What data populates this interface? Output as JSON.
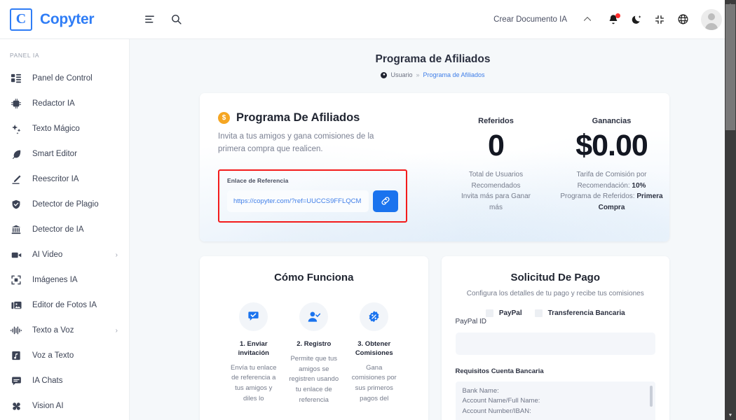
{
  "brand": {
    "logo_letter": "C",
    "name": "Copyter"
  },
  "topbar": {
    "menu_icon": "menu-lines-icon",
    "search_icon": "search-icon",
    "create_document_label": "Crear Documento IA",
    "chevron_up_icon": "chevron-up-icon",
    "notifications_icon": "bell-icon",
    "dark_mode_icon": "moon-icon",
    "fullscreen_icon": "compress-icon",
    "language_icon": "globe-icon",
    "avatar_icon": "user-avatar"
  },
  "sidebar": {
    "section_title": "PANEL IA",
    "items": [
      {
        "label": "Panel de Control",
        "icon": "dashboard-grid-icon",
        "chevron": ""
      },
      {
        "label": "Redactor IA",
        "icon": "ai-chip-icon",
        "chevron": ""
      },
      {
        "label": "Texto Mágico",
        "icon": "sparkles-icon",
        "chevron": ""
      },
      {
        "label": "Smart Editor",
        "icon": "feather-pen-icon",
        "chevron": ""
      },
      {
        "label": "Reescritor IA",
        "icon": "pencil-icon",
        "chevron": ""
      },
      {
        "label": "Detector de Plagio",
        "icon": "shield-check-icon",
        "chevron": ""
      },
      {
        "label": "Detector de IA",
        "icon": "bank-icon",
        "chevron": ""
      },
      {
        "label": "AI Video",
        "icon": "video-camera-icon",
        "chevron": "›"
      },
      {
        "label": "Imágenes IA",
        "icon": "image-frame-icon",
        "chevron": ""
      },
      {
        "label": "Editor de Fotos IA",
        "icon": "photo-edit-icon",
        "chevron": ""
      },
      {
        "label": "Texto a Voz",
        "icon": "waveform-icon",
        "chevron": "›"
      },
      {
        "label": "Voz a Texto",
        "icon": "audio-file-icon",
        "chevron": ""
      },
      {
        "label": "IA Chats",
        "icon": "chat-bubble-icon",
        "chevron": ""
      },
      {
        "label": "Vision AI",
        "icon": "vision-brain-icon",
        "chevron": ""
      }
    ]
  },
  "page": {
    "title": "Programa de Afiliados",
    "breadcrumb": {
      "icon": "user-circle-icon",
      "root": "Usuario",
      "separator": "»",
      "current": "Programa de Afiliados"
    }
  },
  "affiliate_card": {
    "badge_icon": "coin-icon",
    "badge_symbol": "$",
    "title": "Programa De Afiliados",
    "subtitle": "Invita a tus amigos y gana comisiones de la primera compra que realicen.",
    "referral": {
      "label": "Enlace de Referencia",
      "value": "https://copyter.com/?ref=UUCCS9FFLQCM",
      "copy_icon": "link-chain-icon"
    },
    "stats": [
      {
        "label": "Referidos",
        "value": "0",
        "desc_lines": [
          {
            "text": "Total de Usuarios",
            "bold": ""
          },
          {
            "text": "Recomendados",
            "bold": ""
          },
          {
            "text": "Invita más para Ganar",
            "bold": ""
          },
          {
            "text": "más",
            "bold": ""
          }
        ]
      },
      {
        "label": "Ganancias",
        "value": "$0.00",
        "desc_lines": [
          {
            "text": "Tarifa de Comisión por",
            "bold": ""
          },
          {
            "text": "Recomendación: ",
            "bold": "10%"
          },
          {
            "text": "Programa de Referidos: ",
            "bold": "Primera"
          },
          {
            "text": "",
            "bold": "Compra"
          }
        ]
      }
    ]
  },
  "how_it_works": {
    "title": "Cómo Funciona",
    "steps": [
      {
        "icon": "chat-check-icon",
        "title": "1. Enviar invitación",
        "text": "Envía tu enlace de referencia a tus amigos y diles lo"
      },
      {
        "icon": "user-check-icon",
        "title": "2. Registro",
        "text": "Permite que tus amigos se registren usando tu enlace de referencia"
      },
      {
        "icon": "percent-badge-icon",
        "title": "3. Obtener Comisiones",
        "text": "Gana comisiones por sus primeros pagos del"
      }
    ]
  },
  "payout": {
    "title": "Solicitud De Pago",
    "subtitle": "Configura los detalles de tu pago y recibe tus comisiones",
    "methods": [
      {
        "label": "PayPal",
        "selected": false
      },
      {
        "label": "Transferencia Bancaria",
        "selected": false
      }
    ],
    "paypal_id_label": "PayPal ID",
    "paypal_id_value": "",
    "requirements_label": "Requisitos Cuenta Bancaria",
    "requirements_lines": [
      "Bank Name:",
      "Account Name/Full Name:",
      "Account Number/IBAN:"
    ]
  },
  "colors": {
    "brand_blue": "#2f7df6",
    "accent_blue": "#1a73ee",
    "highlight_red": "#f31b1b",
    "coin_orange": "#f5a623",
    "page_bg": "#f5f8fa",
    "notification_red": "#ff2d2d"
  }
}
